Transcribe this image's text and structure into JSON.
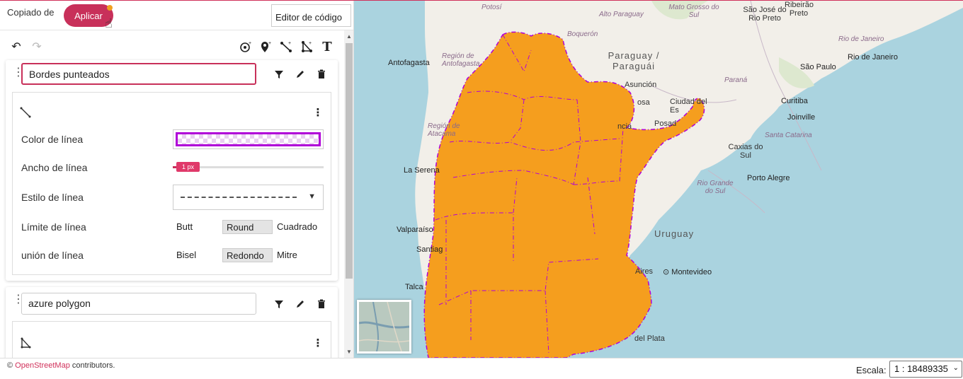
{
  "topbar": {
    "copied_text": "Copiado de",
    "apply_label": "Aplicar",
    "code_editor_label": "Editor de código"
  },
  "toolbar": {
    "undo_icon": "undo-icon",
    "redo_icon": "redo-icon",
    "tools": [
      "add-point-icon",
      "add-marker-icon",
      "add-line-icon",
      "add-polygon-icon",
      "add-text-icon"
    ]
  },
  "layers": [
    {
      "name": "Bordes punteados",
      "geometry_icon": "line-icon",
      "properties": {
        "line_color_label": "Color de línea",
        "line_color": "#b000d8",
        "line_width_label": "Ancho de línea",
        "line_width_value": "1 px",
        "line_style_label": "Estilo de línea",
        "line_cap_label": "Límite de línea",
        "line_cap_options": [
          "Butt",
          "Round",
          "Cuadrado"
        ],
        "line_cap_selected": "Round",
        "line_join_label": "unión de línea",
        "line_join_options": [
          "Bisel",
          "Redondo",
          "Mitre"
        ],
        "line_join_selected": "Redondo"
      }
    },
    {
      "name": "azure polygon",
      "geometry_icon": "polygon-icon"
    }
  ],
  "map": {
    "fill_color": "#f59e1e",
    "border_color": "#b000d8",
    "labels": {
      "potosi": "Potosí",
      "alto_paraguay": "Alto Paraguay",
      "mato_grosso": "Mato Grosso do Sul",
      "sao_jose": "São José do Rio Preto",
      "ribeirao": "Ribeirão Preto",
      "boqueron": "Boquerón",
      "antofagasta": "Antofagasta",
      "region_antofagasta": "Región de Antofagasta",
      "paraguay": "Paraguay / Paraguái",
      "rio_janeiro_state": "Rio de Janeiro",
      "rio_janeiro": "Rio de Janeiro",
      "sao_paulo": "São Paulo",
      "asuncion": "Asunción",
      "parana": "Paraná",
      "curitiba": "Curitiba",
      "region_atacama": "Región de Atacama",
      "posadas": "Posad",
      "ciudad_del_este": "Ciudad del Es",
      "joinville": "Joinville",
      "santa_catarina": "Santa Catarina",
      "caxias": "Caxias do Sul",
      "la_serena": "La Serena",
      "porto_alegre": "Porto Alegre",
      "rio_grande_do_sul": "Rio Grande do Sul",
      "uruguay": "Uruguay",
      "valparaiso": "Valparaíso",
      "santiago": "Santiag",
      "montevideo": "Montevideo",
      "aires": "Aires",
      "talca": "Talca",
      "mar_del_plata": "del Plata",
      "osa": "osa",
      "ncia": "ncia"
    }
  },
  "footer": {
    "copyright": "©",
    "osm_link": "OpenStreetMap",
    "contributors": "contributors.",
    "scale_label": "Escala:",
    "scale_value": "1 : 18489335"
  }
}
